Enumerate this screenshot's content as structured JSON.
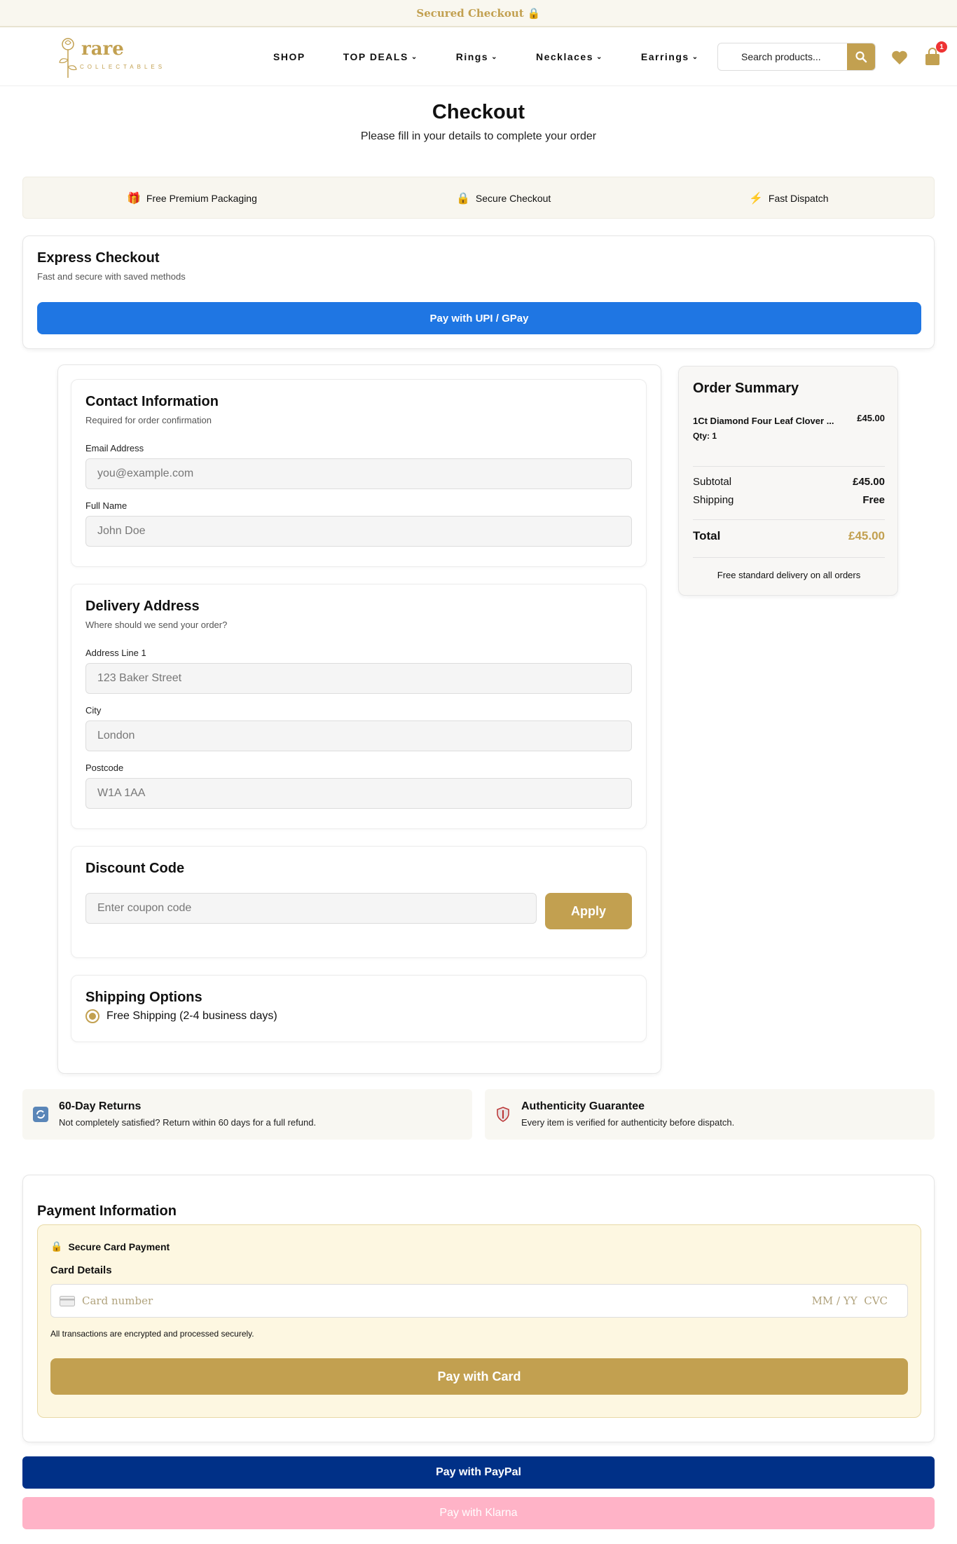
{
  "topbar": {
    "text": "Secured Checkout 🔒"
  },
  "brand": {
    "name": "rare",
    "tagline": "COLLECTABLES"
  },
  "nav": {
    "items": [
      {
        "label": "SHOP"
      },
      {
        "label": "TOP DEALS"
      },
      {
        "label": "Rings"
      },
      {
        "label": "Necklaces"
      },
      {
        "label": "Earrings"
      }
    ],
    "search_placeholder": "Search products...",
    "cart_count": "1"
  },
  "header": {
    "title": "Checkout",
    "subtitle": "Please fill in your details to complete your order"
  },
  "benefits": [
    {
      "icon": "🎁",
      "label": "Free Premium Packaging"
    },
    {
      "icon": "🔒",
      "label": "Secure Checkout"
    },
    {
      "icon": "⚡",
      "label": "Fast Dispatch"
    }
  ],
  "express": {
    "title": "Express Checkout",
    "subtitle": "Fast and secure with saved methods",
    "button": "Pay with UPI / GPay"
  },
  "contact": {
    "title": "Contact Information",
    "hint": "Required for order confirmation",
    "email_label": "Email Address",
    "email_placeholder": "you@example.com",
    "name_label": "Full Name",
    "name_placeholder": "John Doe"
  },
  "delivery": {
    "title": "Delivery Address",
    "hint": "Where should we send your order?",
    "address_label": "Address Line 1",
    "address_placeholder": "123 Baker Street",
    "city_label": "City",
    "city_placeholder": "London",
    "postcode_label": "Postcode",
    "postcode_placeholder": "W1A 1AA"
  },
  "discount": {
    "title": "Discount Code",
    "placeholder": "Enter coupon code",
    "button": "Apply"
  },
  "shipping": {
    "title": "Shipping Options",
    "option": "Free Shipping (2-4 business days)"
  },
  "summary": {
    "title": "Order Summary",
    "item_name": "1Ct Diamond Four Leaf Clover ...",
    "item_price": "£45.00",
    "item_qty": "Qty: 1",
    "subtotal_label": "Subtotal",
    "subtotal_value": "£45.00",
    "shipping_label": "Shipping",
    "shipping_value": "Free",
    "total_label": "Total",
    "total_value": "£45.00",
    "note": "Free standard delivery on all orders"
  },
  "trust": [
    {
      "title": "60-Day Returns",
      "desc": "Not completely satisfied? Return within 60 days for a full refund."
    },
    {
      "title": "Authenticity Guarantee",
      "desc": "Every item is verified for authenticity before dispatch."
    }
  ],
  "payment": {
    "title": "Payment Information",
    "secure_label": "Secure Card Payment",
    "details_label": "Card Details",
    "card_placeholder": "Card number",
    "expiry_cvc": "MM / YY  CVC",
    "note": "All transactions are encrypted and processed securely.",
    "button": "Pay with Card"
  },
  "alt_pay": {
    "paypal": "Pay with PayPal",
    "klarna": "Pay with Klarna"
  },
  "colors": {
    "gold": "#c2a050",
    "blue": "#1f76e3",
    "paypal": "#003087",
    "klarna": "#ffb3c7"
  }
}
